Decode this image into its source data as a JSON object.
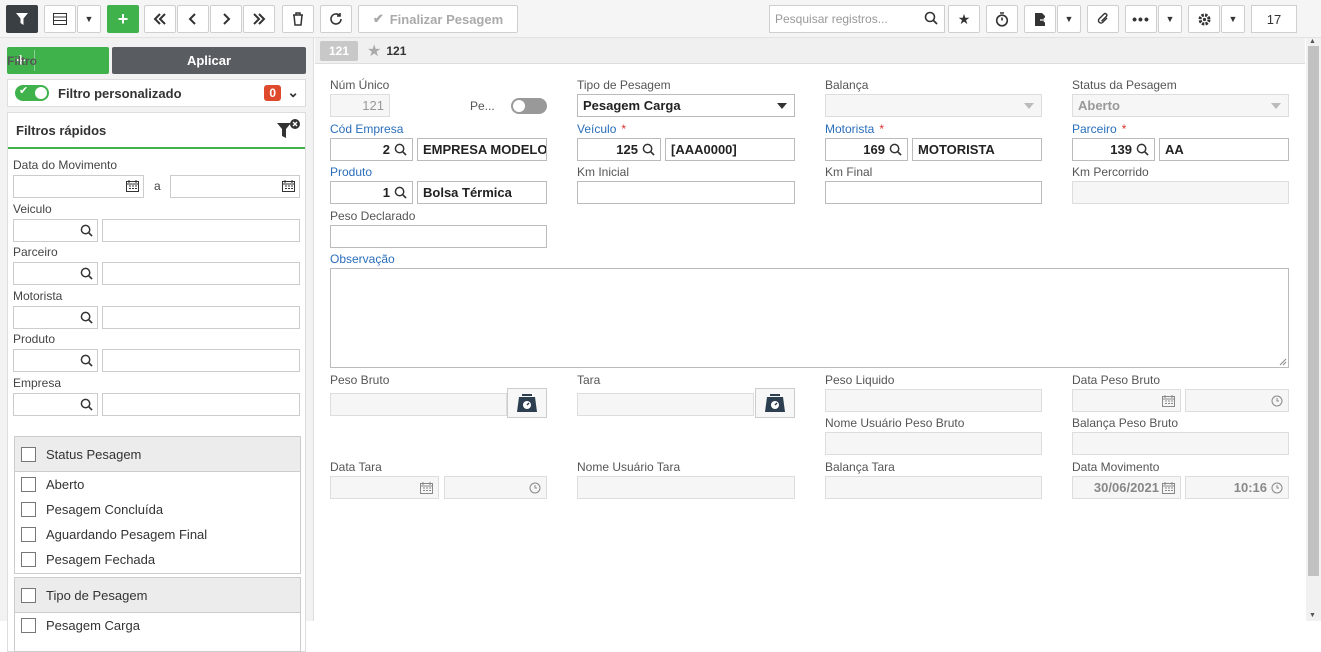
{
  "toolbar": {
    "finalizar_label": "Finalizar Pesagem",
    "search_placeholder": "Pesquisar registros...",
    "page_number": "17"
  },
  "filter_panel": {
    "filtro_label": "Filtro",
    "aplicar_label": "Aplicar",
    "filtro_personalizado_label": "Filtro personalizado",
    "filtro_personalizado_count": "0",
    "filtros_rapidos_label": "Filtros rápidos",
    "data_movimento_label": "Data do Movimento",
    "date_separator": "a",
    "veiculo_label": "Veiculo",
    "parceiro_label": "Parceiro",
    "motorista_label": "Motorista",
    "produto_label": "Produto",
    "empresa_label": "Empresa",
    "status_group": {
      "title": "Status Pesagem",
      "items": [
        "Aberto",
        "Pesagem Concluída",
        "Aguardando Pesagem Final",
        "Pesagem Fechada"
      ]
    },
    "tipo_group": {
      "title": "Tipo de Pesagem",
      "items": [
        "Pesagem Carga"
      ]
    }
  },
  "record": {
    "badge": "121",
    "number": "121"
  },
  "form": {
    "num_unico_label": "Núm Único",
    "num_unico_value": "121",
    "pe_label": "Pe...",
    "tipo_pesagem_label": "Tipo de Pesagem",
    "tipo_pesagem_value": "Pesagem Carga",
    "balanca_label": "Balança",
    "status_pesagem_label": "Status da Pesagem",
    "status_pesagem_value": "Aberto",
    "cod_empresa_label": "Cód Empresa",
    "cod_empresa_value": "2",
    "empresa_nome": "EMPRESA MODELO",
    "veiculo_label": "Veículo",
    "veiculo_value": "125",
    "veiculo_placa": "[AAA0000]",
    "motorista_label": "Motorista",
    "motorista_value": "169",
    "motorista_nome": "MOTORISTA",
    "parceiro_label": "Parceiro",
    "parceiro_value": "139",
    "parceiro_nome": "AA",
    "required_mark": "*",
    "produto_label": "Produto",
    "produto_value": "1",
    "produto_nome": "Bolsa Térmica",
    "km_inicial_label": "Km Inicial",
    "km_final_label": "Km Final",
    "km_percorrido_label": "Km Percorrido",
    "peso_declarado_label": "Peso Declarado",
    "observacao_label": "Observação",
    "peso_bruto_label": "Peso Bruto",
    "tara_label": "Tara",
    "peso_liquido_label": "Peso Liquido",
    "data_peso_bruto_label": "Data Peso Bruto",
    "nome_usuario_peso_bruto_label": "Nome Usuário Peso Bruto",
    "balanca_peso_bruto_label": "Balança Peso Bruto",
    "data_tara_label": "Data Tara",
    "nome_usuario_tara_label": "Nome Usuário Tara",
    "balanca_tara_label": "Balança Tara",
    "data_movimento_label": "Data Movimento",
    "data_movimento_date": "30/06/2021",
    "data_movimento_time": "10:16"
  }
}
